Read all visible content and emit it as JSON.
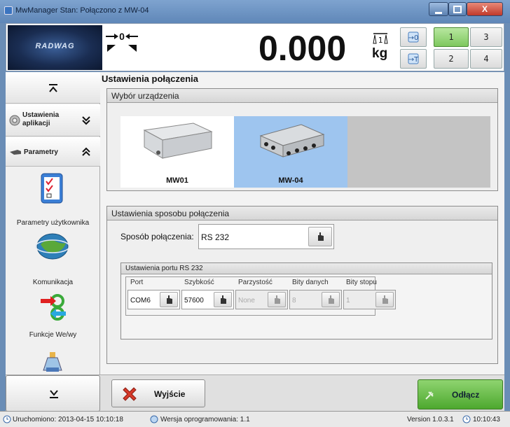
{
  "window": {
    "title": "MwManager  Stan: Połączono z MW-04",
    "close_glyph": "X"
  },
  "header": {
    "logo_text": "RADWAG",
    "zero_digit": "0",
    "weight": "0.000",
    "platform_number": "1",
    "unit": "kg",
    "platform_buttons": [
      "1",
      "2",
      "3",
      "4"
    ]
  },
  "sidebar": {
    "settings_label": "Ustawienia aplikacji",
    "parameters_label": "Parametry",
    "items": [
      {
        "label": "Parametry użytkownika",
        "icon": "checklist-icon"
      },
      {
        "label": "Komunikacja",
        "icon": "globe-icon"
      },
      {
        "label": "Funkcje We/wy",
        "icon": "io-arrows-icon"
      }
    ]
  },
  "main": {
    "title": "Ustawienia połączenia",
    "device_group_title": "Wybór urządzenia",
    "devices": [
      {
        "label": "MW01",
        "selected": false
      },
      {
        "label": "MW-04",
        "selected": true
      }
    ],
    "connection_group_title": "Ustawienia sposobu połączenia",
    "connection_method_label": "Sposób połączenia:",
    "connection_method_value": "RS 232",
    "rs232_group_title": "Ustawienia portu RS 232",
    "rs232_fields": [
      {
        "label": "Port",
        "value": "COM6",
        "enabled": true
      },
      {
        "label": "Szybkość",
        "value": "57600",
        "enabled": true
      },
      {
        "label": "Parzystość",
        "value": "None",
        "enabled": false
      },
      {
        "label": "Bity danych",
        "value": "8",
        "enabled": false
      },
      {
        "label": "Bity stopu",
        "value": "1",
        "enabled": false
      }
    ]
  },
  "bottom": {
    "exit_label": "Wyjście",
    "disconnect_label": "Odłącz"
  },
  "status": {
    "started": "Uruchomiono: 2013-04-15 10:10:18",
    "software_version": "Wersja oprogramowania: 1.1",
    "version": "Version 1.0.3.1",
    "time": "10:10:43"
  },
  "colors": {
    "selected_device_bg": "#9ec5ef",
    "accent_green": "#5bb53a",
    "exit_red": "#d63a2a"
  }
}
